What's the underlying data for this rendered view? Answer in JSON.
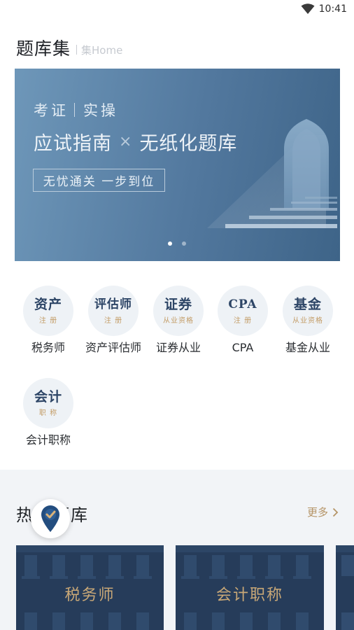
{
  "status_bar": {
    "time": "10:41"
  },
  "header": {
    "title": "题库集",
    "subtitle": "集Home"
  },
  "banner": {
    "category_left": "考证",
    "category_right": "实操",
    "headline_left": "应试指南",
    "headline_sep": "×",
    "headline_right": "无纸化题库",
    "tagline": "无忧通关 一步到位",
    "slide_count": 2,
    "active_slide": 1
  },
  "categories": [
    {
      "big": "资产",
      "small": "注 册",
      "label": "税务师"
    },
    {
      "big": "评估师",
      "small": "注 册",
      "label": "资产评估师"
    },
    {
      "big": "证券",
      "small": "从业资格",
      "label": "证券从业"
    },
    {
      "big": "CPA",
      "small": "注 册",
      "label": "CPA"
    },
    {
      "big": "基金",
      "small": "从业资格",
      "label": "基金从业"
    },
    {
      "big": "会计",
      "small": "职 称",
      "label": "会计职称"
    }
  ],
  "hot": {
    "title": "热门题库",
    "more_label": "更多",
    "cards": [
      {
        "label": "税务师"
      },
      {
        "label": "会计职称"
      }
    ]
  },
  "colors": {
    "banner_start": "#6e97b9",
    "banner_end": "#3e6488",
    "navy": "#263c5a",
    "gold": "#c39c66",
    "section_bg": "#f2f4f7"
  },
  "icons": {
    "wifi": "wifi-icon",
    "chevron": "chevron-right-icon",
    "fab": "location-check-icon"
  }
}
